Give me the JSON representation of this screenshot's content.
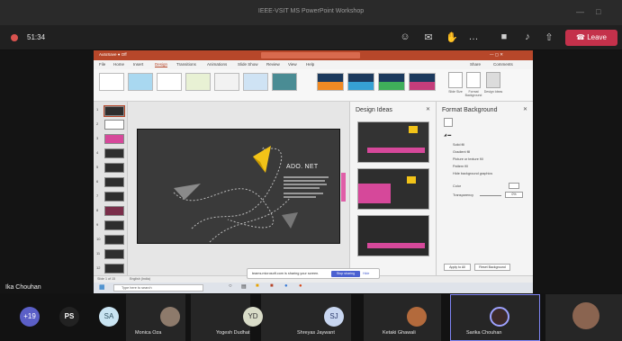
{
  "window": {
    "title": "IEEE-VSIT MS PowerPoint Workshop"
  },
  "call": {
    "timer": "51:34",
    "leave_label": "Leave"
  },
  "ppt": {
    "tabs": [
      "File",
      "Home",
      "Insert",
      "Design",
      "Transitions",
      "Animations",
      "Slide Show",
      "Review",
      "View",
      "Help"
    ],
    "active_tab": "Design",
    "share_label": "Share",
    "comments_label": "Comments",
    "slide_title": "ADO. NET",
    "design_ideas_title": "Design Ideas",
    "format_background_title": "Format Background",
    "fill_options": [
      "Solid fill",
      "Gradient fill",
      "Picture or texture fill",
      "Pattern fill",
      "Hide background graphics"
    ],
    "color_label": "Color",
    "transparency_label": "Transparency",
    "transparency_value": "0%",
    "apply_all_label": "Apply to All",
    "reset_bg_label": "Reset Background",
    "slide_size_label": "Slide Size",
    "format_bg_btn_label": "Format Background",
    "design_ideas_btn_label": "Design Ideas",
    "status_left": "Slide 1 of 15",
    "status_lang": "English (India)",
    "share_notice": "teams.microsoft.com is sharing your screen.",
    "stop_sharing_label": "Stop sharing",
    "hide_label": "Hide",
    "search_placeholder": "Type here to search",
    "thumb_numbers": [
      "1",
      "2",
      "3",
      "4",
      "5",
      "6",
      "7",
      "8",
      "9",
      "10",
      "11",
      "12"
    ]
  },
  "presenter": {
    "name": "Ika Chouhan"
  },
  "participants": [
    {
      "initials": "+19",
      "name": "",
      "color": "#5b5fc7"
    },
    {
      "initials": "PS",
      "name": "",
      "color": "#222222"
    },
    {
      "initials": "SA",
      "name": "",
      "color": "#c9e4f2"
    },
    {
      "initials": "",
      "name": "Monica Oza",
      "color": "#8d7a6b"
    },
    {
      "initials": "YD",
      "name": "Yogesh Dudhat",
      "color": "#d9dcc8"
    },
    {
      "initials": "SJ",
      "name": "Shreyas Jaywant",
      "color": "#c8d6f0"
    },
    {
      "initials": "",
      "name": "Ketaki Ghawali",
      "color": "#b36a3c"
    },
    {
      "initials": "",
      "name": "Sarika Chouhan",
      "color": "#3d2a2a"
    },
    {
      "initials": "",
      "name": "",
      "color": "#8a6450"
    }
  ]
}
